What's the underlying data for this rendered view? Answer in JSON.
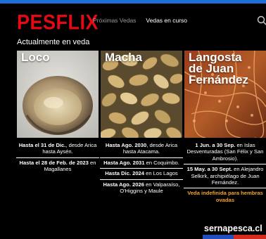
{
  "brand": {
    "logo": "PESFLIX",
    "site": "sernapesca.cl"
  },
  "nav": {
    "upcoming": "Próximas Vedas",
    "current": "Vedas en curso"
  },
  "section_title": "Actualmente en veda",
  "cards": [
    {
      "title_lines": [
        "Loco"
      ],
      "entries": [
        {
          "bold": "Hasta el 31 de Dic.",
          "rest": ", desde Arica hasta Aysén."
        },
        {
          "bold": "Hasta el 28 de Feb. de 2023",
          "rest": " en Magallanes"
        }
      ]
    },
    {
      "title_lines": [
        "Macha"
      ],
      "entries": [
        {
          "bold": "Hasta Ago. 2030",
          "rest": ", desde Arica hasta Atacama."
        },
        {
          "bold": "Hasta Ago. 2031",
          "rest": " en Coquimbo."
        },
        {
          "bold": "Hasta Dic. 2024",
          "rest": " en Los Lagos"
        },
        {
          "bold": "Hasta Ago. 2026",
          "rest": " en Valparaíso, O'Higgins y Maule"
        }
      ]
    },
    {
      "title_lines": [
        "Langosta",
        "de Juan",
        "Fernández"
      ],
      "entries": [
        {
          "bold": "1 Jun. a 30 Sep.",
          "rest": " en Islas Desventuradas (San Félix y San Ambrosio)."
        },
        {
          "bold": "15 May. a 30 Sept.",
          "rest": " en Alejandro Selkirk, archipiélago de Juan Fernández."
        },
        {
          "orange": "Veda indefinida para hembras ovadas"
        }
      ]
    }
  ],
  "colors": {
    "logo_red": "#e50914",
    "accent_blue": "#1f6fd8",
    "highlight_orange": "#f5a623",
    "flag_red": "#d52b1e"
  },
  "icons": {
    "search": "search-icon"
  }
}
